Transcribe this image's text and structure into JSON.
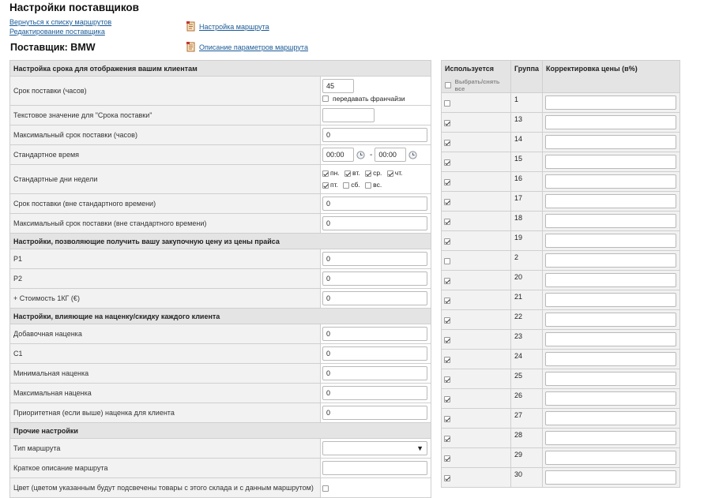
{
  "page": {
    "title": "Настройки поставщиков",
    "links": {
      "back": "Вернуться к списку маршрутов",
      "edit_supplier": "Редактирование поставщика",
      "route_settings": "Настройка маршрута",
      "route_params": "Описание параметров маршрута"
    },
    "supplier_title": "Поставщик: BMW"
  },
  "settings": {
    "section_delivery": "Настройка срока для отображения вашим клиентам",
    "delivery_term_label": "Срок поставки (часов)",
    "delivery_term_value": "45",
    "franchise_label": "передавать франчайзи",
    "franchise_checked": false,
    "text_term_label": "Текстовое значение для \"Срока поставки\"",
    "text_term_value": "",
    "max_term_label": "Максимальный срок поставки (часов)",
    "max_term_value": "0",
    "std_time_label": "Стандартное время",
    "std_time_from": "00:00",
    "std_time_sep": "-",
    "std_time_to": "00:00",
    "std_days_label": "Стандартные дни недели",
    "days": [
      {
        "label": "пн.",
        "checked": true
      },
      {
        "label": "вт.",
        "checked": true
      },
      {
        "label": "ср.",
        "checked": true
      },
      {
        "label": "чт.",
        "checked": true
      },
      {
        "label": "пт.",
        "checked": true
      },
      {
        "label": "сб.",
        "checked": false
      },
      {
        "label": "вс.",
        "checked": false
      }
    ],
    "term_nonstd_label": "Срок поставки (вне стандартного времени)",
    "term_nonstd_value": "0",
    "max_term_nonstd_label": "Максимальный срок поставки (вне стандартного времени)",
    "max_term_nonstd_value": "0",
    "section_purchase": "Настройки, позволяющие получить вашу закупочную цену из цены прайса",
    "p1_label": "P1",
    "p1_value": "0",
    "p2_label": "P2",
    "p2_value": "0",
    "kg_label": "+ Стоимость 1КГ (€)",
    "kg_value": "0",
    "section_markup": "Настройки, влияющие на наценку/скидку каждого клиента",
    "add_markup_label": "Добавочная наценка",
    "add_markup_value": "0",
    "c1_label": "C1",
    "c1_value": "0",
    "min_markup_label": "Минимальная наценка",
    "min_markup_value": "0",
    "max_markup_label": "Максимальная наценка",
    "max_markup_value": "0",
    "priority_markup_label": "Приоритетная (если выше) наценка для клиента",
    "priority_markup_value": "0",
    "section_other": "Прочие настройки",
    "route_type_label": "Тип маршрута",
    "route_type_value": "",
    "short_desc_label": "Краткое описание маршрута",
    "short_desc_value": "",
    "cut_row_label": "Цвет (цветом указанным будут подсвечены товары с этого склада и с данным маршрутом)"
  },
  "groups": {
    "col_used": "Используется",
    "select_all": "Выбрать/снять все",
    "col_group": "Группа",
    "col_adjust": "Корректировка цены (в%)",
    "rows": [
      {
        "group": "1",
        "used": false,
        "adjust": ""
      },
      {
        "group": "13",
        "used": true,
        "adjust": ""
      },
      {
        "group": "14",
        "used": true,
        "adjust": ""
      },
      {
        "group": "15",
        "used": true,
        "adjust": ""
      },
      {
        "group": "16",
        "used": true,
        "adjust": ""
      },
      {
        "group": "17",
        "used": true,
        "adjust": ""
      },
      {
        "group": "18",
        "used": true,
        "adjust": ""
      },
      {
        "group": "19",
        "used": true,
        "adjust": ""
      },
      {
        "group": "2",
        "used": false,
        "adjust": ""
      },
      {
        "group": "20",
        "used": true,
        "adjust": ""
      },
      {
        "group": "21",
        "used": true,
        "adjust": ""
      },
      {
        "group": "22",
        "used": true,
        "adjust": ""
      },
      {
        "group": "23",
        "used": true,
        "adjust": ""
      },
      {
        "group": "24",
        "used": true,
        "adjust": ""
      },
      {
        "group": "25",
        "used": true,
        "adjust": ""
      },
      {
        "group": "26",
        "used": true,
        "adjust": ""
      },
      {
        "group": "27",
        "used": true,
        "adjust": ""
      },
      {
        "group": "28",
        "used": true,
        "adjust": ""
      },
      {
        "group": "29",
        "used": true,
        "adjust": ""
      },
      {
        "group": "30",
        "used": true,
        "adjust": ""
      }
    ]
  },
  "icons": {
    "doc": "document-icon",
    "clock": "clock-icon",
    "dropdown": "triangle-down-icon"
  },
  "colors": {
    "link": "#1a5a96",
    "section_bg": "#e4e4e4",
    "label_bg": "#f2f2f2",
    "border": "#cfcfcf"
  }
}
